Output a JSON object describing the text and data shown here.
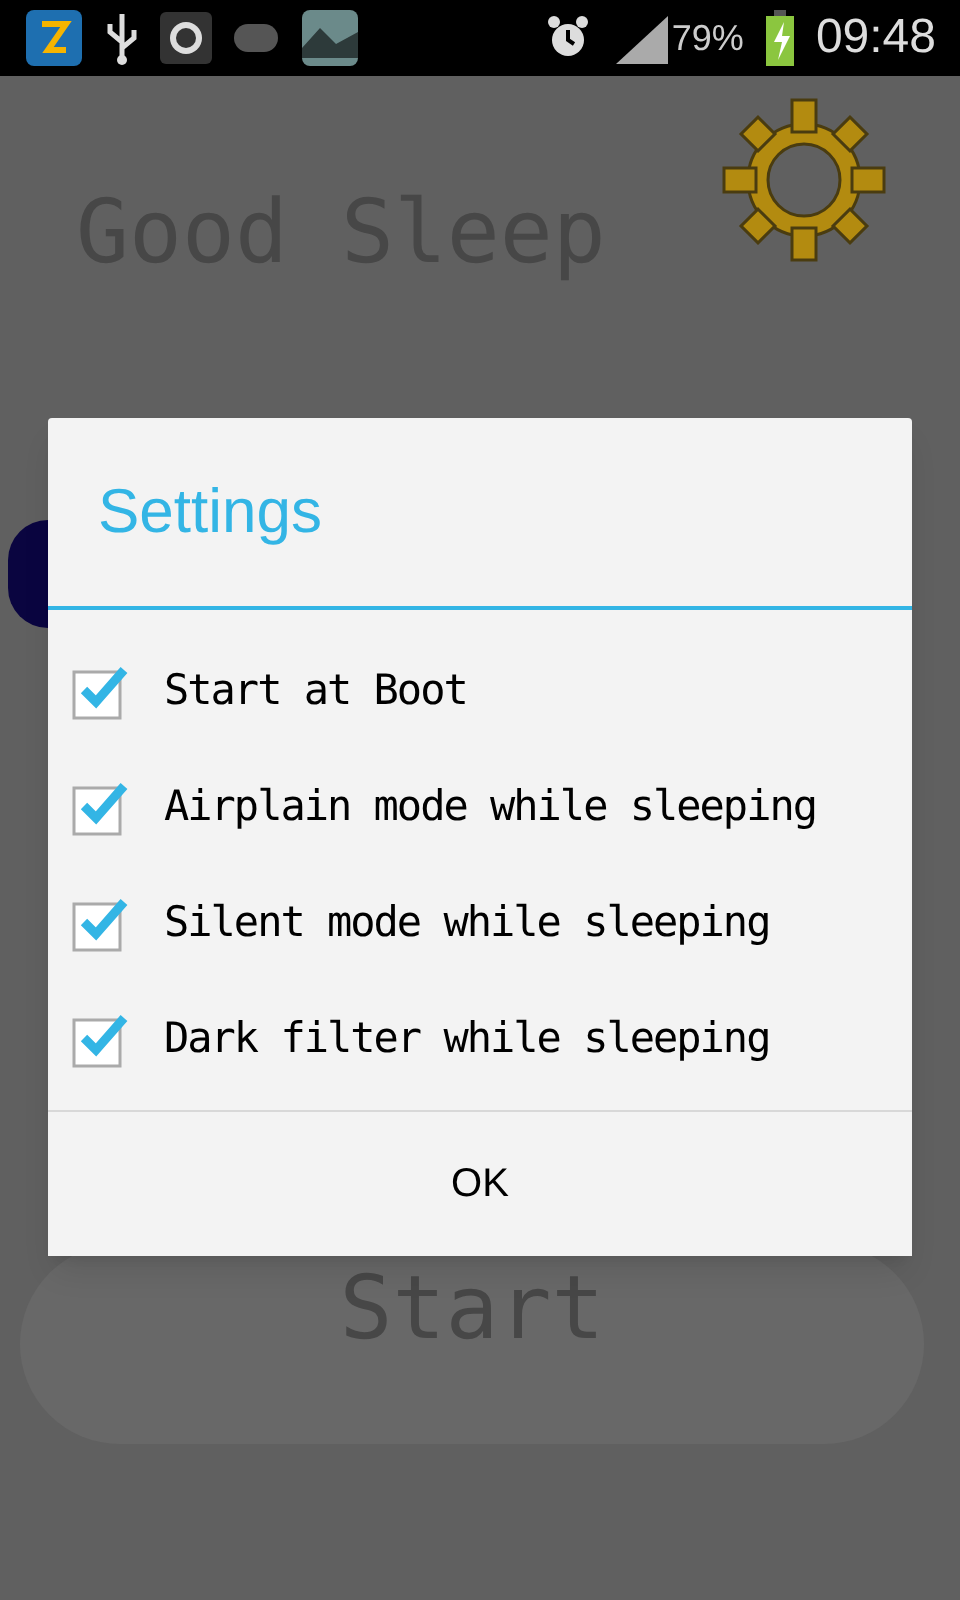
{
  "status_bar": {
    "battery": "79%",
    "time": "09:48"
  },
  "app": {
    "title": "Good Sleep",
    "start_label": "Start"
  },
  "dialog": {
    "title": "Settings",
    "options": [
      {
        "label": "Start at Boot",
        "checked": true
      },
      {
        "label": "Airplain mode while sleeping",
        "checked": true
      },
      {
        "label": "Silent mode while sleeping",
        "checked": true
      },
      {
        "label": "Dark filter while sleeping",
        "checked": true
      }
    ],
    "button": "OK"
  }
}
